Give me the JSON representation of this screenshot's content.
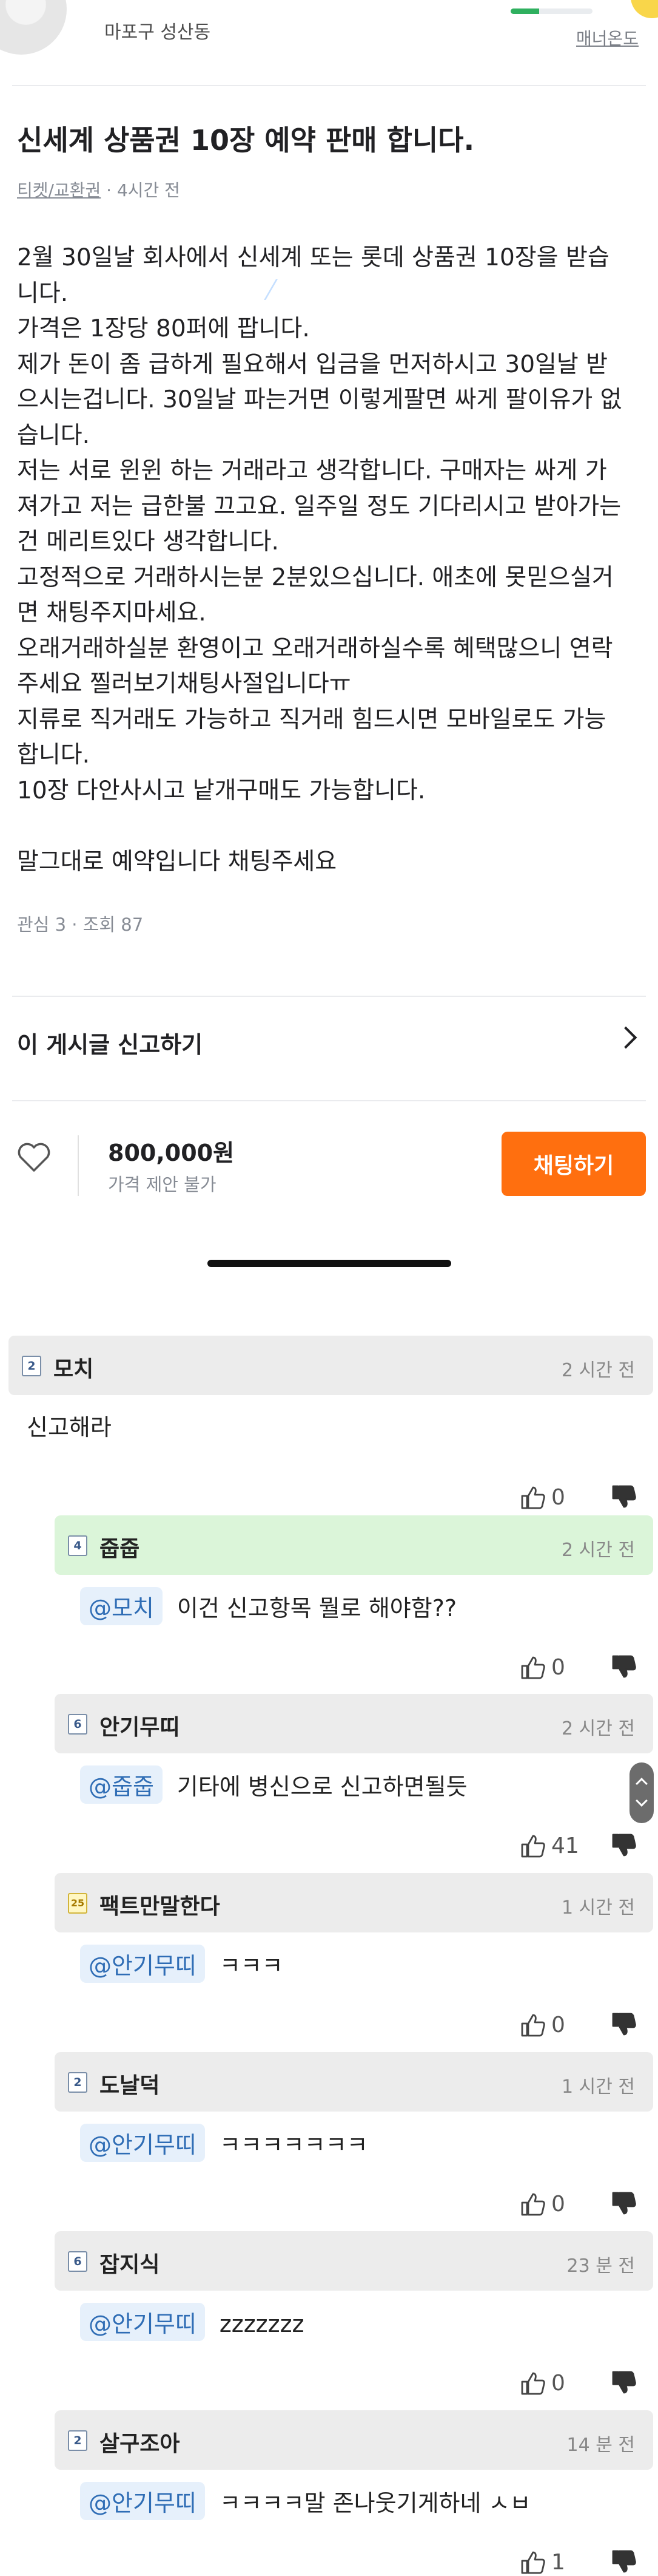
{
  "seller": {
    "location": "마포구 성산동",
    "manner_label": "매너온도",
    "manner_level": 0.35,
    "manner_color": "#2fb05f"
  },
  "article": {
    "title": "신세계 상품권 10장 예약 판매 합니다.",
    "category": "티켓/교환권",
    "time": "· 4시간 전",
    "lines": [
      "2월 30일날 회사에서 신세계 또는 롯데 상품권 10장을 받습",
      "니다.",
      "가격은 1장당 80퍼에 팝니다.",
      "제가 돈이 좀 급하게 필요해서 입금을 먼저하시고 30일날 받",
      "으시는겁니다. 30일날 파는거면 이렇게팔면 싸게 팔이유가 없",
      "습니다.",
      "저는 서로 윈윈 하는 거래라고 생각합니다. 구매자는 싸게 가",
      "져가고 저는 급한불 끄고요. 일주일 정도 기다리시고 받아가는",
      "건 메리트있다 생각합니다.",
      "고정적으로 거래하시는분 2분있으십니다. 애초에 못믿으실거",
      "면 채팅주지마세요.",
      "오래거래하실분 환영이고 오래거래하실수록 혜택많으니 연락",
      "주세요 찔러보기채팅사절입니다ㅠ",
      "지류로 직거래도 가능하고 직거래 힘드시면 모바일로도 가능",
      "합니다.",
      "10장 다안사시고 낱개구매도 가능합니다.",
      "",
      "말그대로 예약입니다 채팅주세요"
    ],
    "stats": "관심 3 · 조회 87"
  },
  "report": {
    "label": "이 게시글 신고하기"
  },
  "buy": {
    "price": "800,000원",
    "negotiation": "가격 제안 불가",
    "chat_button": "채팅하기",
    "accent": "#ff6f0f"
  },
  "comments": [
    {
      "level": "2",
      "nick": "모치",
      "time": "2 시간 전",
      "mention": "",
      "text": "신고해라",
      "likes": "0",
      "head": "grey"
    },
    {
      "level": "4",
      "nick": "줍줍",
      "time": "2 시간 전",
      "mention": "@모치",
      "text": "이건 신고항목 뭘로 해야함??",
      "likes": "0",
      "head": "green"
    },
    {
      "level": "6",
      "nick": "안기무띠",
      "time": "2 시간 전",
      "mention": "@줍줍",
      "text": "기타에 병신으로 신고하면될듯",
      "likes": "41",
      "head": "grey"
    },
    {
      "level": "25",
      "nick": "팩트만말한다",
      "time": "1 시간 전",
      "mention": "@안기무띠",
      "text": "ㅋㅋㅋ",
      "likes": "0",
      "head": "grey"
    },
    {
      "level": "2",
      "nick": "도날덕",
      "time": "1 시간 전",
      "mention": "@안기무띠",
      "text": "ㅋㅋㅋㅋㅋㅋㅋ",
      "likes": "0",
      "head": "grey"
    },
    {
      "level": "6",
      "nick": "잡지식",
      "time": "23 분 전",
      "mention": "@안기무띠",
      "text": "zzzzzzz",
      "likes": "0",
      "head": "grey"
    },
    {
      "level": "2",
      "nick": "살구조아",
      "time": "14 분 전",
      "mention": "@안기무띠",
      "text": "ㅋㅋㅋㅋ말 존나웃기게하네 ㅅㅂ",
      "likes": "1",
      "head": "grey"
    }
  ],
  "icons": {
    "heart": "heart-icon",
    "thumb_up": "thumbs-up-icon",
    "thumb_down": "thumbs-down-icon",
    "chevron": "chevron-right-icon",
    "level_badge": "level-badge-icon"
  }
}
